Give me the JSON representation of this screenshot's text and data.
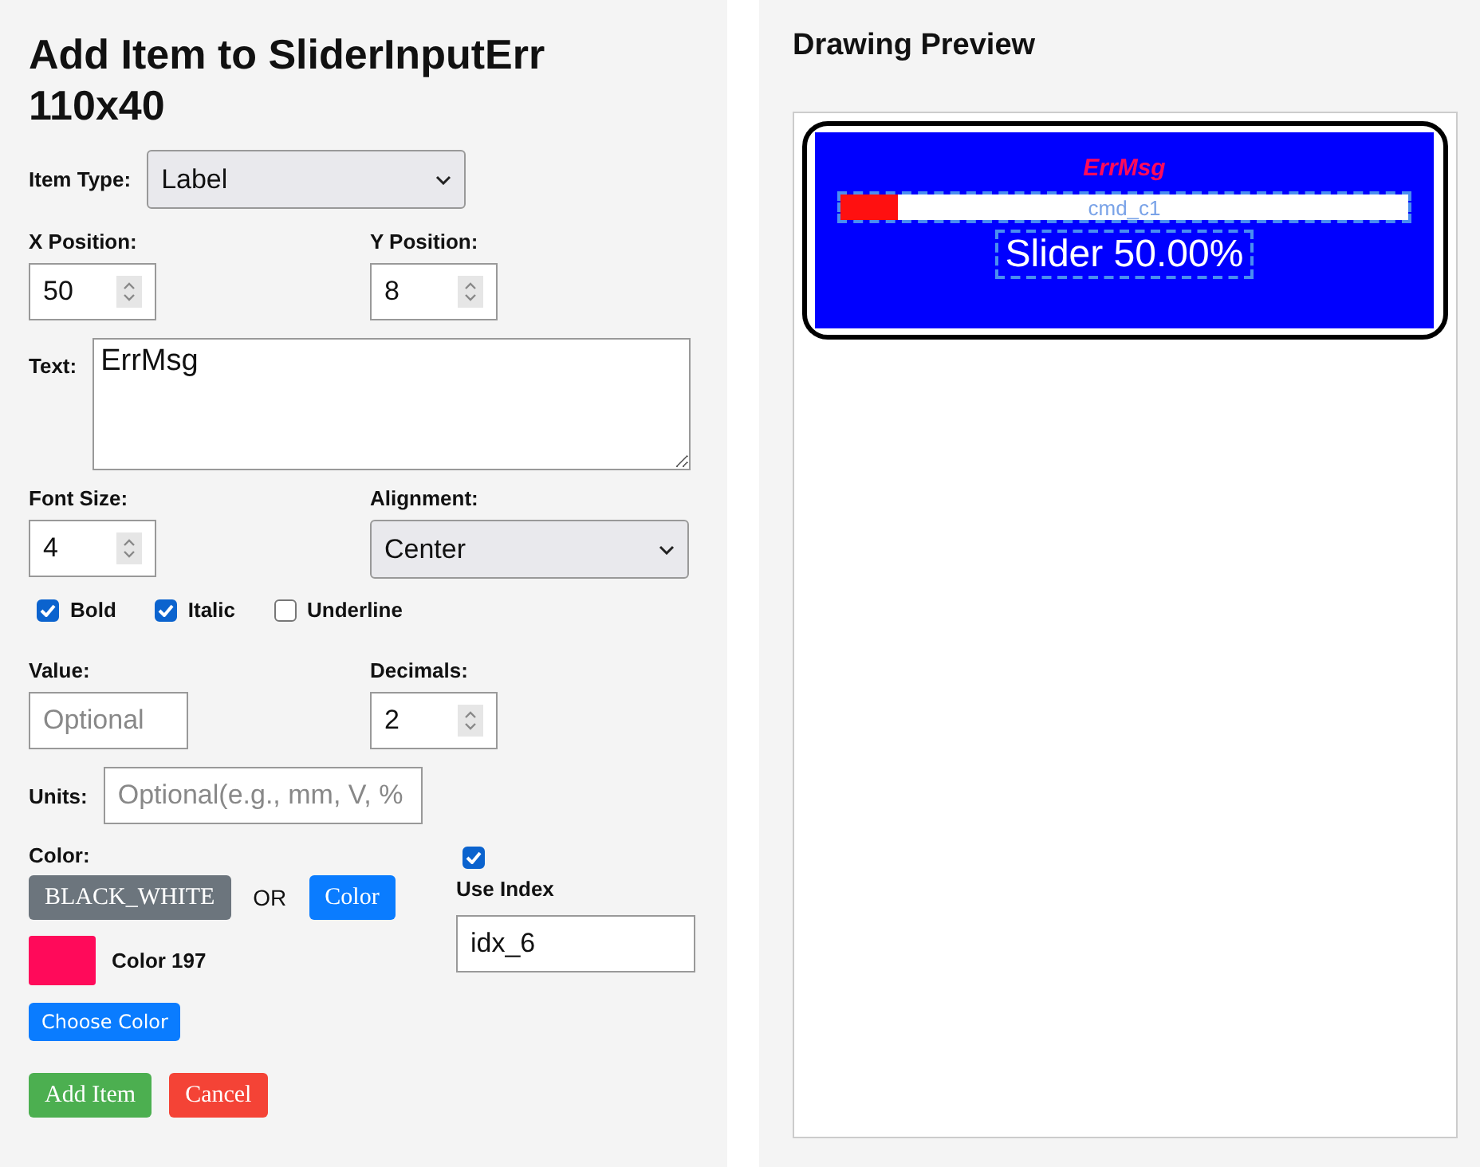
{
  "title": "Add Item to SliderInputErr 110x40",
  "item_type": {
    "label": "Item Type:",
    "value": "Label"
  },
  "x_position": {
    "label": "X Position:",
    "value": "50"
  },
  "y_position": {
    "label": "Y Position:",
    "value": "8"
  },
  "text": {
    "label": "Text:",
    "value": "ErrMsg"
  },
  "font_size": {
    "label": "Font Size:",
    "value": "4"
  },
  "alignment": {
    "label": "Alignment:",
    "value": "Center"
  },
  "styles": [
    {
      "label": "Bold",
      "checked": true
    },
    {
      "label": "Italic",
      "checked": true
    },
    {
      "label": "Underline",
      "checked": false
    }
  ],
  "value": {
    "label": "Value:",
    "placeholder": "Optional"
  },
  "decimals": {
    "label": "Decimals:",
    "value": "2"
  },
  "units": {
    "label": "Units:",
    "placeholder": "Optional(e.g., mm, V, %"
  },
  "color": {
    "label": "Color:",
    "palette_button": "BLACK_WHITE",
    "or": "OR",
    "color_button": "Color",
    "swatch": {
      "color": "#ff0a5a",
      "name": "Color 197"
    },
    "choose_button": "Choose Color"
  },
  "use_index": {
    "checked": true,
    "label": "Use Index",
    "value": "idx_6"
  },
  "actions": [
    {
      "label": "Add Item",
      "kind": "primary"
    },
    {
      "label": "Cancel",
      "kind": "danger"
    }
  ],
  "preview": {
    "title": "Drawing Preview",
    "items": [
      {
        "kind": "label",
        "text": "ErrMsg"
      },
      {
        "kind": "slider",
        "level": 0.1,
        "text": "cmd_c1"
      },
      {
        "kind": "value",
        "text": "Slider 50.00%"
      }
    ]
  }
}
